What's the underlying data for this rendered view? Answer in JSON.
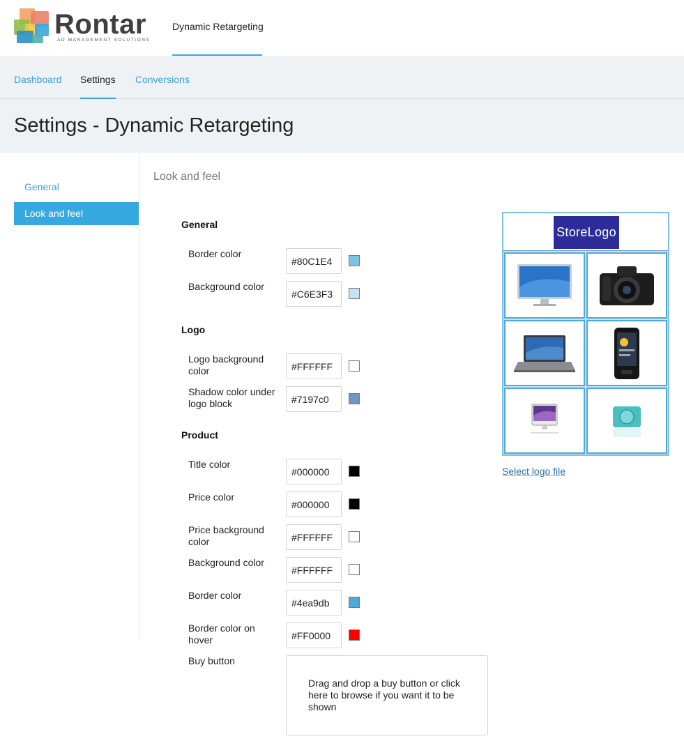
{
  "brand": {
    "name": "Rontar",
    "tagline": "AD MANAGEMENT SOLUTIONS",
    "colors": [
      "#f4a261",
      "#e76f51",
      "#3aa6dc",
      "#8bc34a",
      "#2a9d8f"
    ]
  },
  "top_nav": {
    "active_tab": "Dynamic Retargeting"
  },
  "sub_nav": {
    "items": [
      {
        "label": "Dashboard",
        "active": false
      },
      {
        "label": "Settings",
        "active": true
      },
      {
        "label": "Conversions",
        "active": false
      }
    ]
  },
  "page": {
    "title": "Settings - Dynamic Retargeting"
  },
  "sidebar": {
    "items": [
      {
        "label": "General",
        "active": false
      },
      {
        "label": "Look and feel",
        "active": true
      }
    ]
  },
  "main": {
    "section_title": "Look and feel",
    "groups": {
      "general": {
        "title": "General",
        "fields": [
          {
            "label": "Border color",
            "value": "#80C1E4",
            "swatch": "#80C1E4"
          },
          {
            "label": "Background color",
            "value": "#C6E3F3",
            "swatch": "#C6E3F3"
          }
        ]
      },
      "logo": {
        "title": "Logo",
        "fields": [
          {
            "label": "Logo background color",
            "value": "#FFFFFF",
            "swatch": "#FFFFFF"
          },
          {
            "label": "Shadow color under logo block",
            "value": "#7197c0",
            "swatch": "#7197c0"
          }
        ]
      },
      "product": {
        "title": "Product",
        "fields": [
          {
            "label": "Title color",
            "value": "#000000",
            "swatch": "#000000"
          },
          {
            "label": "Price color",
            "value": "#000000",
            "swatch": "#000000"
          },
          {
            "label": "Price background color",
            "value": "#FFFFFF",
            "swatch": "#FFFFFF"
          },
          {
            "label": "Background color",
            "value": "#FFFFFF",
            "swatch": "#FFFFFF"
          },
          {
            "label": "Border color",
            "value": "#4ea9db",
            "swatch": "#4ea9db"
          },
          {
            "label": "Border color on hover",
            "value": "#FF0000",
            "swatch": "#FF0000"
          }
        ],
        "buy_button_label": "Buy button",
        "dropzone_text": "Drag and drop a buy button or click here to browse if you want it to be shown"
      }
    }
  },
  "preview": {
    "store_logo_text": "StoreLogo",
    "products": [
      "monitor-image",
      "dslr-camera-image",
      "laptop-image",
      "smartphone-image",
      "imac-image",
      "mp3-player-image"
    ],
    "select_logo_link": "Select logo file"
  }
}
